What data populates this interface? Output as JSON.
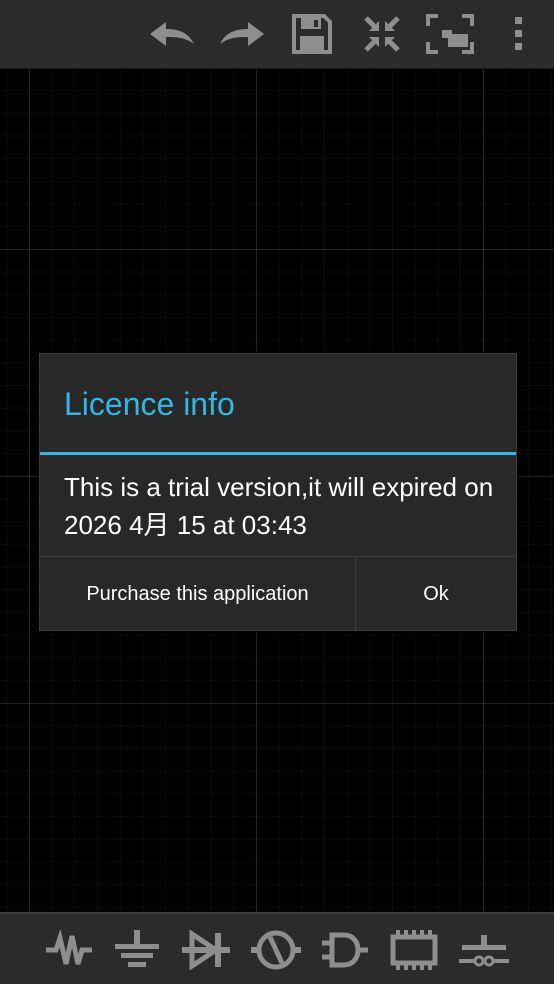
{
  "colors": {
    "accent": "#33b5e5",
    "toolbar": "#2b2b2b",
    "icon": "#8e8e8e",
    "dialog_bg": "#282828",
    "canvas_bg": "#000000"
  },
  "top_toolbar": {
    "icons": [
      "undo-icon",
      "redo-icon",
      "save-icon",
      "exit-fullscreen-icon",
      "fit-screen-icon",
      "overflow-menu-icon"
    ]
  },
  "bottom_toolbar": {
    "icons": [
      "resistor-icon",
      "ground-icon",
      "diode-icon",
      "source-icon",
      "logic-gate-icon",
      "chip-icon",
      "switch-icon"
    ]
  },
  "dialog": {
    "title": "Licence info",
    "message": "This is a trial version,it will expired on 2026 4月 15 at 03:43",
    "purchase_label": "Purchase this application",
    "ok_label": "Ok"
  }
}
